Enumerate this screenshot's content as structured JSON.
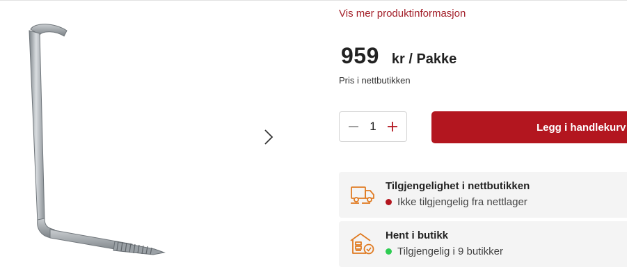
{
  "product": {
    "more_info_link": "Vis mer produktinformasjon",
    "price_amount": "959",
    "price_unit": "kr / Pakke",
    "price_note": "Pris i nettbutikken"
  },
  "cart": {
    "quantity": "1",
    "add_label": "Legg i handlekurv"
  },
  "availability": [
    {
      "title": "Tilgjengelighet i nettbutikken",
      "status": "Ikke tilgjengelig fra nettlager",
      "status_color": "#b3161f",
      "icon": "delivery-truck-icon"
    },
    {
      "title": "Hent i butikk",
      "status": "Tilgjengelig i 9 butikker",
      "status_color": "#2ecc52",
      "icon": "store-pickup-icon"
    }
  ],
  "colors": {
    "accent": "#b3161f",
    "link": "#a3202a",
    "icon_orange": "#e07b22"
  }
}
